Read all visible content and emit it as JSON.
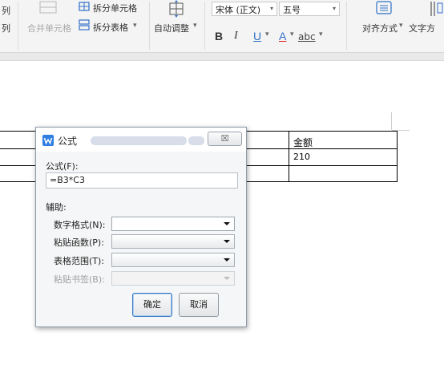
{
  "ribbon": {
    "row1_left": "列",
    "row2_left": "列",
    "split_cell": "拆分单元格",
    "merge_cell": "合并单元格",
    "split_table": "拆分表格",
    "split_table_arrow": "▾",
    "auto_adjust": "自动调整",
    "auto_adjust_arrow": "▾",
    "font_name": "宋体 (正文)",
    "font_size": "五号",
    "bold": "B",
    "italic": "I",
    "underline": "U",
    "font_color": "A",
    "phonetic": "abc",
    "align": "对齐方式",
    "text_dir": "文字方",
    "dropdown_arrow": "▾"
  },
  "table": {
    "header_amount": "金额",
    "value_amount": "210"
  },
  "dialog": {
    "title": "公式",
    "close_glyph": "☒",
    "formula_label": "公式(F):",
    "formula_value": "=B3*C3",
    "assist_label": "辅助:",
    "number_format_label": "数字格式(N):",
    "paste_function_label": "粘贴函数(P):",
    "table_range_label": "表格范围(T):",
    "paste_bookmark_label": "粘贴书签(B):",
    "ok_label": "确定",
    "cancel_label": "取消"
  },
  "colors": {
    "accent": "#2f7ee2",
    "ribbon_bg": "#f4f4f4",
    "dialog_bg": "#f5f6f7"
  }
}
